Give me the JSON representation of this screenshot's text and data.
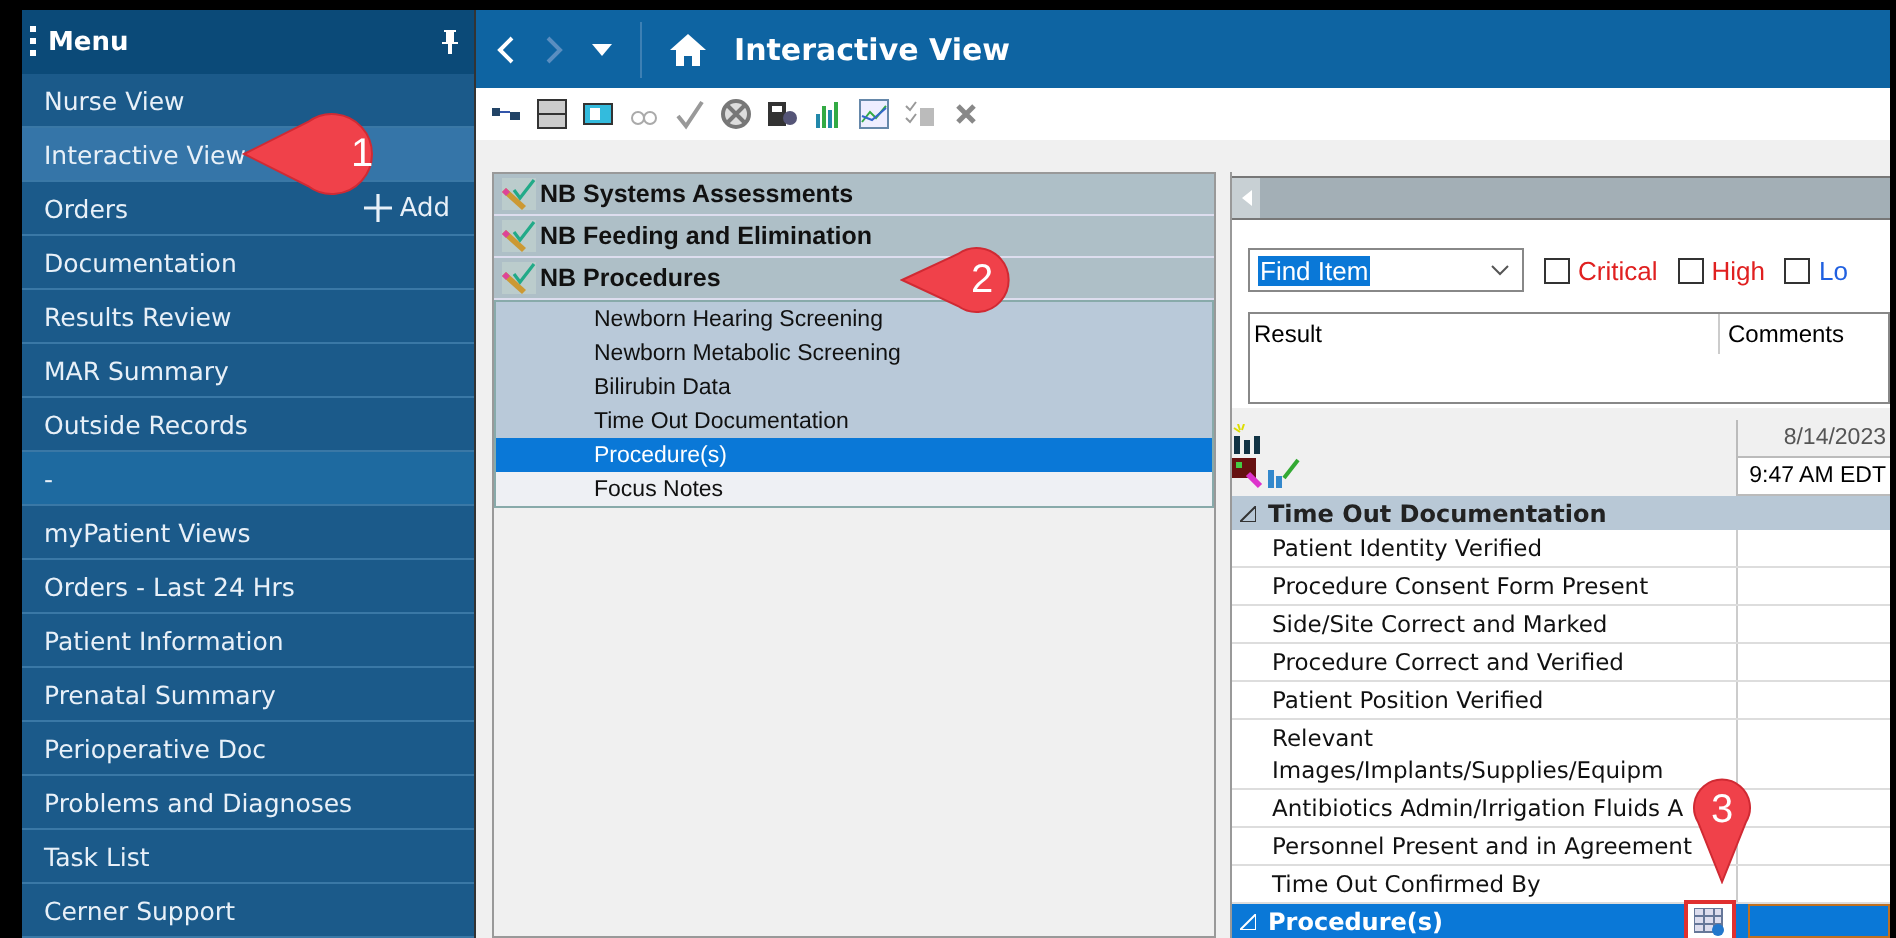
{
  "menu": {
    "title": "Menu",
    "items": [
      {
        "label": "Nurse View",
        "selected": false
      },
      {
        "label": "Interactive View",
        "selected": true
      },
      {
        "label": "Orders",
        "selected": false,
        "action": "Add"
      },
      {
        "label": "Documentation",
        "selected": false
      },
      {
        "label": "Results Review",
        "selected": false
      },
      {
        "label": "MAR Summary",
        "selected": false
      },
      {
        "label": "Outside Records",
        "selected": false
      },
      {
        "label": "-",
        "selected": false,
        "kind": "separator"
      },
      {
        "label": "myPatient Views",
        "selected": false
      },
      {
        "label": "Orders - Last 24 Hrs",
        "selected": false
      },
      {
        "label": "Patient Information",
        "selected": false
      },
      {
        "label": "Prenatal Summary",
        "selected": false
      },
      {
        "label": "Perioperative Doc",
        "selected": false
      },
      {
        "label": "Problems and Diagnoses",
        "selected": false
      },
      {
        "label": "Task List",
        "selected": false
      },
      {
        "label": "Cerner Support",
        "selected": false
      }
    ]
  },
  "header": {
    "title": "Interactive View"
  },
  "bands": [
    {
      "title": "NB Systems Assessments"
    },
    {
      "title": "NB Feeding and Elimination"
    },
    {
      "title": "NB Procedures",
      "children": [
        {
          "label": "Newborn Hearing Screening",
          "selected": false
        },
        {
          "label": "Newborn Metabolic Screening",
          "selected": false
        },
        {
          "label": "Bilirubin Data",
          "selected": false
        },
        {
          "label": "Time Out Documentation",
          "selected": false
        },
        {
          "label": "Procedure(s)",
          "selected": true
        },
        {
          "label": "Focus Notes",
          "selected": false
        }
      ]
    }
  ],
  "find": {
    "value": "Find Item",
    "filters": [
      {
        "label": "Critical",
        "checked": false,
        "color": "#e02020"
      },
      {
        "label": "High",
        "checked": false,
        "color": "#e02020"
      },
      {
        "label": "Lo",
        "checked": false,
        "color": "#2060e0"
      }
    ]
  },
  "results": {
    "columns": [
      "Result",
      "Comments"
    ]
  },
  "grid": {
    "date": "8/14/2023",
    "time": "9:47 AM EDT",
    "groups": [
      {
        "title": "Time Out Documentation",
        "selected": false,
        "rows": [
          "Patient Identity Verified",
          "Procedure Consent Form Present",
          "Side/Site Correct and Marked",
          "Procedure Correct and Verified",
          "Patient Position Verified",
          "Relevant Images/Implants/Supplies/Equipm",
          "Antibiotics Admin/Irrigation Fluids A",
          "Personnel Present and in Agreement",
          "Time Out Confirmed By"
        ]
      },
      {
        "title": "Procedure(s)",
        "selected": true
      }
    ]
  },
  "callouts": [
    "1",
    "2",
    "3"
  ]
}
